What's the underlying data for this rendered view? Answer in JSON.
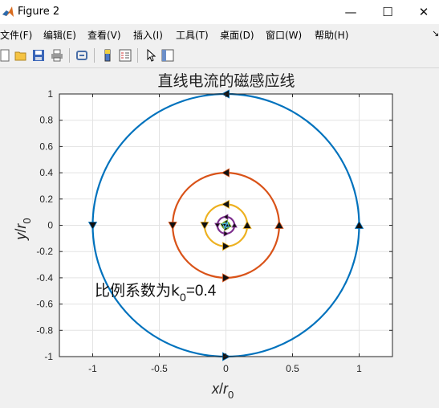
{
  "window": {
    "title": "Figure 2",
    "minimize": "—",
    "maximize": "☐",
    "close": "✕"
  },
  "menu": [
    {
      "label": "文件(F)"
    },
    {
      "label": "编辑(E)"
    },
    {
      "label": "查看(V)"
    },
    {
      "label": "插入(I)"
    },
    {
      "label": "工具(T)"
    },
    {
      "label": "桌面(D)"
    },
    {
      "label": "窗口(W)"
    },
    {
      "label": "帮助(H)"
    }
  ],
  "toolbar": [
    "new-icon",
    "open-icon",
    "save-icon",
    "print-icon",
    "link-icon",
    "colorbar-icon",
    "legend-icon",
    "pointer-icon",
    "property-inspector-icon"
  ],
  "chart_data": {
    "type": "line",
    "title": "直线电流的磁感应线",
    "xlabel": "x/r0",
    "ylabel": "y/r0",
    "xlim": [
      -1.25,
      1.25
    ],
    "ylim": [
      -1,
      1
    ],
    "xticks": [
      "-1",
      "-0.5",
      "0",
      "0.5",
      "1"
    ],
    "yticks": [
      "1",
      "0.8",
      "0.6",
      "0.4",
      "0.2",
      "0",
      "-0.2",
      "-0.4",
      "-0.6",
      "-0.8",
      "-1"
    ],
    "grid": true,
    "annotation": "比例系数为k0=0.4",
    "annotation_parts": {
      "prefix": "比例系数为k",
      "sub": "0",
      "suffix": "=0.4"
    },
    "series": [
      {
        "radius": 1.0,
        "color": "#0072bd"
      },
      {
        "radius": 0.4,
        "color": "#d95319"
      },
      {
        "radius": 0.16,
        "color": "#edb120"
      },
      {
        "radius": 0.064,
        "color": "#7e2f8e"
      },
      {
        "radius": 0.0256,
        "color": "#77ac30"
      },
      {
        "radius": 0.01024,
        "color": "#4dbeee"
      }
    ]
  }
}
